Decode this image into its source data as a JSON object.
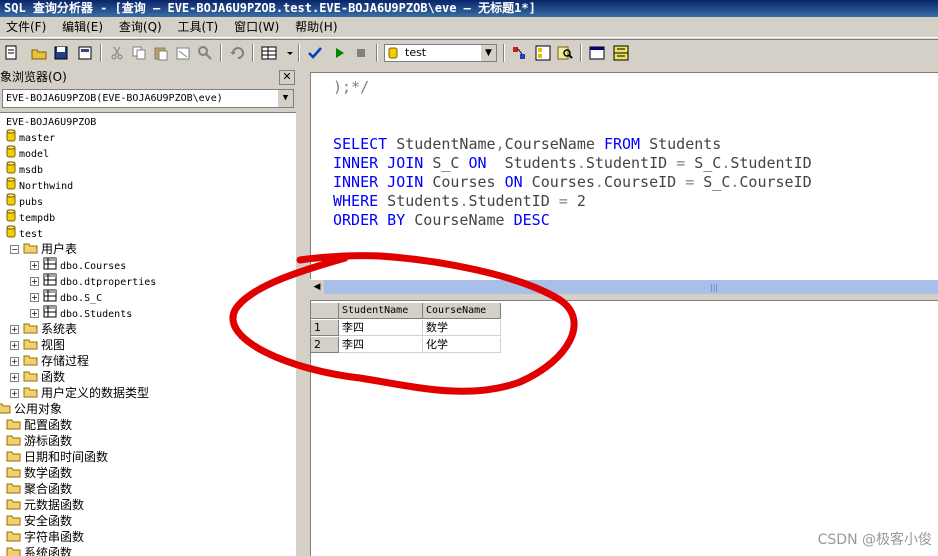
{
  "window": {
    "title": "SQL 查询分析器 - [查询 — EVE-BOJA6U9PZOB.test.EVE-BOJA6U9PZOB\\eve — 无标题1*]"
  },
  "menubar": {
    "items": [
      "文件(F)",
      "编辑(E)",
      "查询(Q)",
      "工具(T)",
      "窗口(W)",
      "帮助(H)"
    ]
  },
  "toolbar": {
    "database": "test"
  },
  "object_browser": {
    "title": "象浏览器(O)",
    "close": "✕",
    "server": "EVE-BOJA6U9PZOB(EVE-BOJA6U9PZOB\\eve)",
    "root": "EVE-BOJA6U9PZOB",
    "databases": [
      "master",
      "model",
      "msdb",
      "Northwind",
      "pubs",
      "tempdb",
      "test"
    ],
    "user_tables_label": "用户表",
    "tables": [
      "dbo.Courses",
      "dbo.dtproperties",
      "dbo.S_C",
      "dbo.Students"
    ],
    "test_children": [
      "系统表",
      "视图",
      "存储过程",
      "函数",
      "用户定义的数据类型"
    ],
    "common_objects": "公用对象",
    "common_children": [
      "配置函数",
      "游标函数",
      "日期和时间函数",
      "数学函数",
      "聚合函数",
      "元数据函数",
      "安全函数",
      "字符串函数",
      "系统函数"
    ]
  },
  "editor": {
    "lines": [
      {
        "parts": [
          {
            "t": ");*/",
            "c": "op"
          }
        ]
      },
      {
        "parts": []
      },
      {
        "parts": []
      },
      {
        "parts": [
          {
            "t": "SELECT",
            "c": "kw"
          },
          {
            "t": " StudentName",
            "c": ""
          },
          {
            "t": ",",
            "c": "op"
          },
          {
            "t": "CourseName ",
            "c": ""
          },
          {
            "t": "FROM",
            "c": "kw"
          },
          {
            "t": " Students",
            "c": ""
          }
        ]
      },
      {
        "parts": [
          {
            "t": "INNER JOIN",
            "c": "kw"
          },
          {
            "t": " S_C ",
            "c": ""
          },
          {
            "t": "ON",
            "c": "kw"
          },
          {
            "t": "  Students",
            "c": ""
          },
          {
            "t": ".",
            "c": "op"
          },
          {
            "t": "StudentID ",
            "c": ""
          },
          {
            "t": "=",
            "c": "op"
          },
          {
            "t": " S_C",
            "c": ""
          },
          {
            "t": ".",
            "c": "op"
          },
          {
            "t": "StudentID",
            "c": ""
          }
        ]
      },
      {
        "parts": [
          {
            "t": "INNER JOIN",
            "c": "kw"
          },
          {
            "t": " Courses ",
            "c": ""
          },
          {
            "t": "ON",
            "c": "kw"
          },
          {
            "t": " Courses",
            "c": ""
          },
          {
            "t": ".",
            "c": "op"
          },
          {
            "t": "CourseID ",
            "c": ""
          },
          {
            "t": "=",
            "c": "op"
          },
          {
            "t": " S_C",
            "c": ""
          },
          {
            "t": ".",
            "c": "op"
          },
          {
            "t": "CourseID",
            "c": ""
          }
        ]
      },
      {
        "parts": [
          {
            "t": "WHERE",
            "c": "kw"
          },
          {
            "t": " Students",
            "c": ""
          },
          {
            "t": ".",
            "c": "op"
          },
          {
            "t": "StudentID ",
            "c": ""
          },
          {
            "t": "=",
            "c": "op"
          },
          {
            "t": " 2",
            "c": ""
          }
        ]
      },
      {
        "parts": [
          {
            "t": "ORDER BY",
            "c": "kw"
          },
          {
            "t": " CourseName ",
            "c": ""
          },
          {
            "t": "DESC",
            "c": "kw"
          }
        ]
      }
    ]
  },
  "results": {
    "columns": [
      "StudentName",
      "CourseName"
    ],
    "rows": [
      {
        "num": "1",
        "cells": [
          "李四",
          "数学"
        ]
      },
      {
        "num": "2",
        "cells": [
          "李四",
          "化学"
        ]
      }
    ]
  },
  "watermark": "CSDN @极客小俊",
  "colors": {
    "keyword": "#0000ff",
    "annotation": "#e00000",
    "titlebar": "#0a246a"
  }
}
